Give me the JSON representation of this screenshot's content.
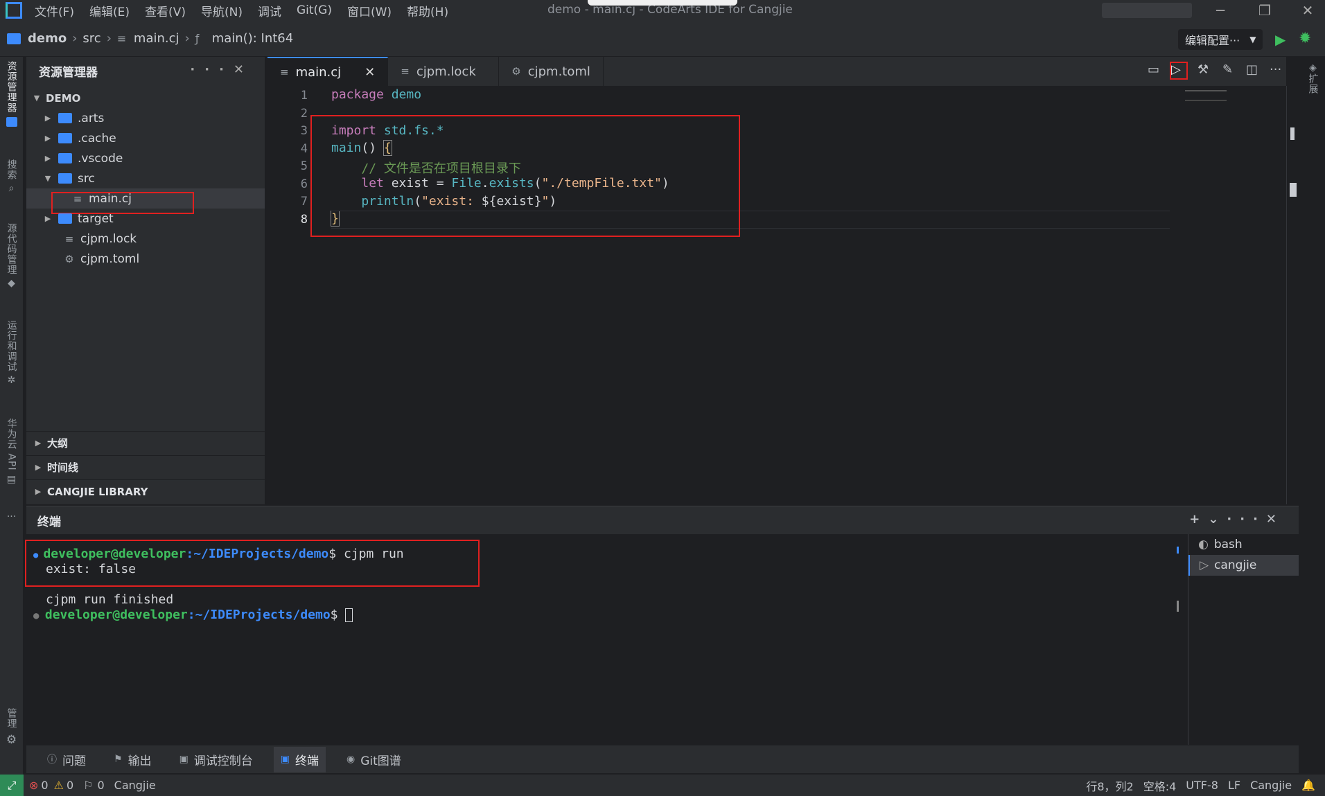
{
  "window": {
    "title": "demo - main.cj - CodeArts IDE for Cangjie",
    "menu": [
      "文件(F)",
      "编辑(E)",
      "查看(V)",
      "导航(N)",
      "调试",
      "Git(G)",
      "窗口(W)",
      "帮助(H)"
    ]
  },
  "breadcrumb": {
    "project": "demo",
    "folder": "src",
    "file": "main.cj",
    "symbol": "main(): Int64",
    "config_label": "编辑配置···"
  },
  "activitybar": [
    "资源管理器",
    "搜索",
    "源代码管理",
    "运行和调试",
    "华为云 API",
    "管理",
    "扩展"
  ],
  "sidebar": {
    "title": "资源管理器",
    "root": "DEMO",
    "tree": [
      {
        "name": ".arts",
        "type": "folder"
      },
      {
        "name": ".cache",
        "type": "folder"
      },
      {
        "name": ".vscode",
        "type": "folder"
      },
      {
        "name": "src",
        "type": "folder-open"
      },
      {
        "name": "main.cj",
        "type": "file"
      },
      {
        "name": "target",
        "type": "folder"
      },
      {
        "name": "cjpm.lock",
        "type": "file"
      },
      {
        "name": "cjpm.toml",
        "type": "gear"
      }
    ],
    "sections": [
      "大纲",
      "时间线",
      "CANGJIE LIBRARY"
    ]
  },
  "tabs": [
    {
      "label": "main.cj",
      "active": true
    },
    {
      "label": "cjpm.lock",
      "active": false
    },
    {
      "label": "cjpm.toml",
      "active": false
    }
  ],
  "code": {
    "line_numbers": [
      "1",
      "2",
      "3",
      "4",
      "5",
      "6",
      "7",
      "8"
    ]
  },
  "panel": {
    "title": "终端",
    "prompt_user": "developer@developer",
    "prompt_path": ":~/IDEProjects/demo",
    "command": "$ cjpm run",
    "output1": "exist: false",
    "output2": "cjpm run finished",
    "prompt_end": "$ ",
    "terminals": [
      "bash",
      "cangjie"
    ]
  },
  "bottom_tabs": [
    "问题",
    "输出",
    "调试控制台",
    "终端",
    "Git图谱"
  ],
  "status": {
    "errors": "0",
    "warnings": "0",
    "ports": "0",
    "language": "Cangjie",
    "position": "行8，列2",
    "spaces": "空格:4",
    "encoding": "UTF-8",
    "eol": "LF",
    "mode": "Cangjie"
  }
}
